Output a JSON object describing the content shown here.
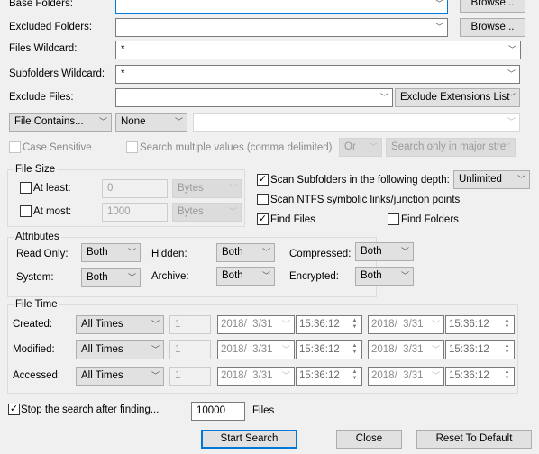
{
  "base_folders": {
    "label": "Base Folders:",
    "value": "",
    "browse": "Browse..."
  },
  "excluded_folders": {
    "label": "Excluded Folders:",
    "value": "",
    "browse": "Browse..."
  },
  "files_wildcard": {
    "label": "Files Wildcard:",
    "value": "*"
  },
  "subfolders_wildcard": {
    "label": "Subfolders Wildcard:",
    "value": "*"
  },
  "exclude_files": {
    "label": "Exclude Files:",
    "value": "",
    "mode": "Exclude Extensions List"
  },
  "file_contains": {
    "mode": "File Contains...",
    "type": "None",
    "value": "",
    "case_sensitive": "Case Sensitive",
    "multiple": "Search multiple values (comma delimited)",
    "logic": "Or",
    "streams": "Search only in major stre"
  },
  "file_size": {
    "title": "File Size",
    "at_least": {
      "label": "At least:",
      "value": "0",
      "unit": "Bytes",
      "checked": false
    },
    "at_most": {
      "label": "At most:",
      "value": "1000",
      "unit": "Bytes",
      "checked": false
    }
  },
  "scan": {
    "subfolders": "Scan Subfolders in the following depth:",
    "depth": "Unlimited",
    "ntfs": "Scan NTFS symbolic links/junction points",
    "find_files": "Find Files",
    "find_folders": "Find Folders"
  },
  "attributes": {
    "title": "Attributes",
    "read_only": "Read Only:",
    "hidden": "Hidden:",
    "compressed": "Compressed:",
    "system": "System:",
    "archive": "Archive:",
    "encrypted": "Encrypted:",
    "value": "Both"
  },
  "file_time": {
    "title": "File Time",
    "rows": [
      {
        "label": "Created:",
        "mode": "All Times",
        "count": "1",
        "date1": "2018/  3/31",
        "time1": "15:36:12",
        "date2": "2018/  3/31",
        "time2": "15:36:12"
      },
      {
        "label": "Modified:",
        "mode": "All Times",
        "count": "1",
        "date1": "2018/  3/31",
        "time1": "15:36:12",
        "date2": "2018/  3/31",
        "time2": "15:36:12"
      },
      {
        "label": "Accessed:",
        "mode": "All Times",
        "count": "1",
        "date1": "2018/  3/31",
        "time1": "15:36:12",
        "date2": "2018/  3/31",
        "time2": "15:36:12"
      }
    ]
  },
  "stop": {
    "label": "Stop the search after finding...",
    "value": "10000",
    "unit": "Files",
    "checked": true
  },
  "buttons": {
    "start": "Start Search",
    "close": "Close",
    "reset": "Reset To Default"
  },
  "icons": {
    "dropdown": "chevron-down-icon",
    "check": "checkmark-icon",
    "spin": "spinner-icon"
  }
}
